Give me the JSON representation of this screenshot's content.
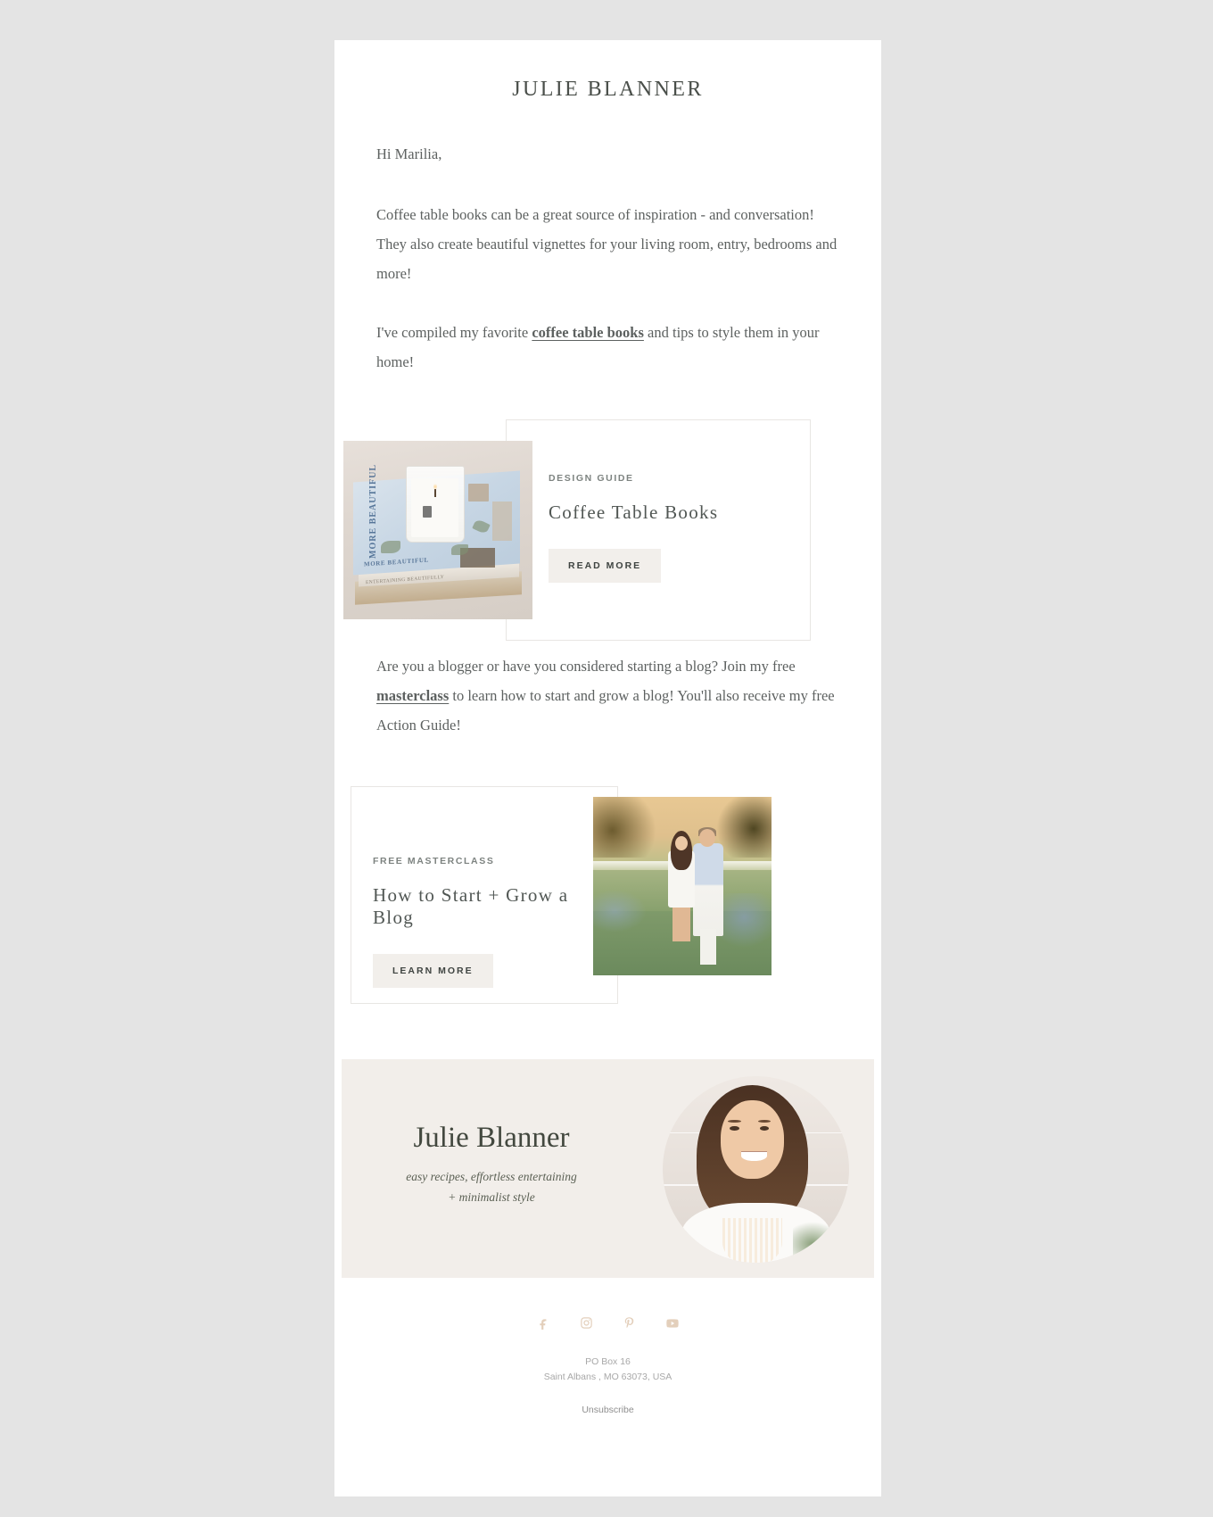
{
  "theme": {
    "page_background": "#e4e4e4",
    "content_background": "#ffffff",
    "text_color": "#5d6160",
    "button_background": "#f2efeb",
    "signature_background": "#f2eeea",
    "social_icon_color": "#e3cfbb",
    "frame_border": "#e8e6e3"
  },
  "header": {
    "brand": "JULIE BLANNER"
  },
  "body": {
    "greeting": "Hi Marilia,",
    "paragraph_1": "Coffee table books can be a great source of inspiration - and conversation! They also create beautiful vignettes for your living room, entry, bedrooms and more!",
    "paragraph_2_before_link": "I've compiled my favorite ",
    "paragraph_2_link": "coffee table books",
    "paragraph_2_after_link": " and tips to style them in your home!",
    "paragraph_3_before_link": "Are you a blogger or have you considered starting a blog? Join my free ",
    "paragraph_3_link": "masterclass",
    "paragraph_3_after_link": " to learn how to start and grow a blog! You'll also receive my free Action Guide!"
  },
  "promo_design_guide": {
    "eyebrow": "DESIGN GUIDE",
    "title": "Coffee Table Books",
    "cta_label": "READ MORE",
    "image_alt": "stack-of-coffee-table-books-with-candle"
  },
  "promo_masterclass": {
    "eyebrow": "FREE MASTERCLASS",
    "title": "How to Start + Grow a Blog",
    "cta_label": "LEARN MORE",
    "image_alt": "couple-in-lavender-field"
  },
  "signature": {
    "name": "Julie Blanner",
    "tagline_line_1": "easy recipes, effortless entertaining",
    "tagline_line_2": "+ minimalist style",
    "portrait_alt": "julie-blanner-portrait"
  },
  "footer": {
    "social": [
      {
        "name": "facebook",
        "glyph": "f"
      },
      {
        "name": "instagram",
        "glyph": "instagram"
      },
      {
        "name": "pinterest",
        "glyph": "P"
      },
      {
        "name": "youtube",
        "glyph": "youtube"
      }
    ],
    "address_line_1": "PO Box 16",
    "address_line_2": "Saint Albans , MO 63073, USA",
    "unsubscribe_label": "Unsubscribe"
  }
}
